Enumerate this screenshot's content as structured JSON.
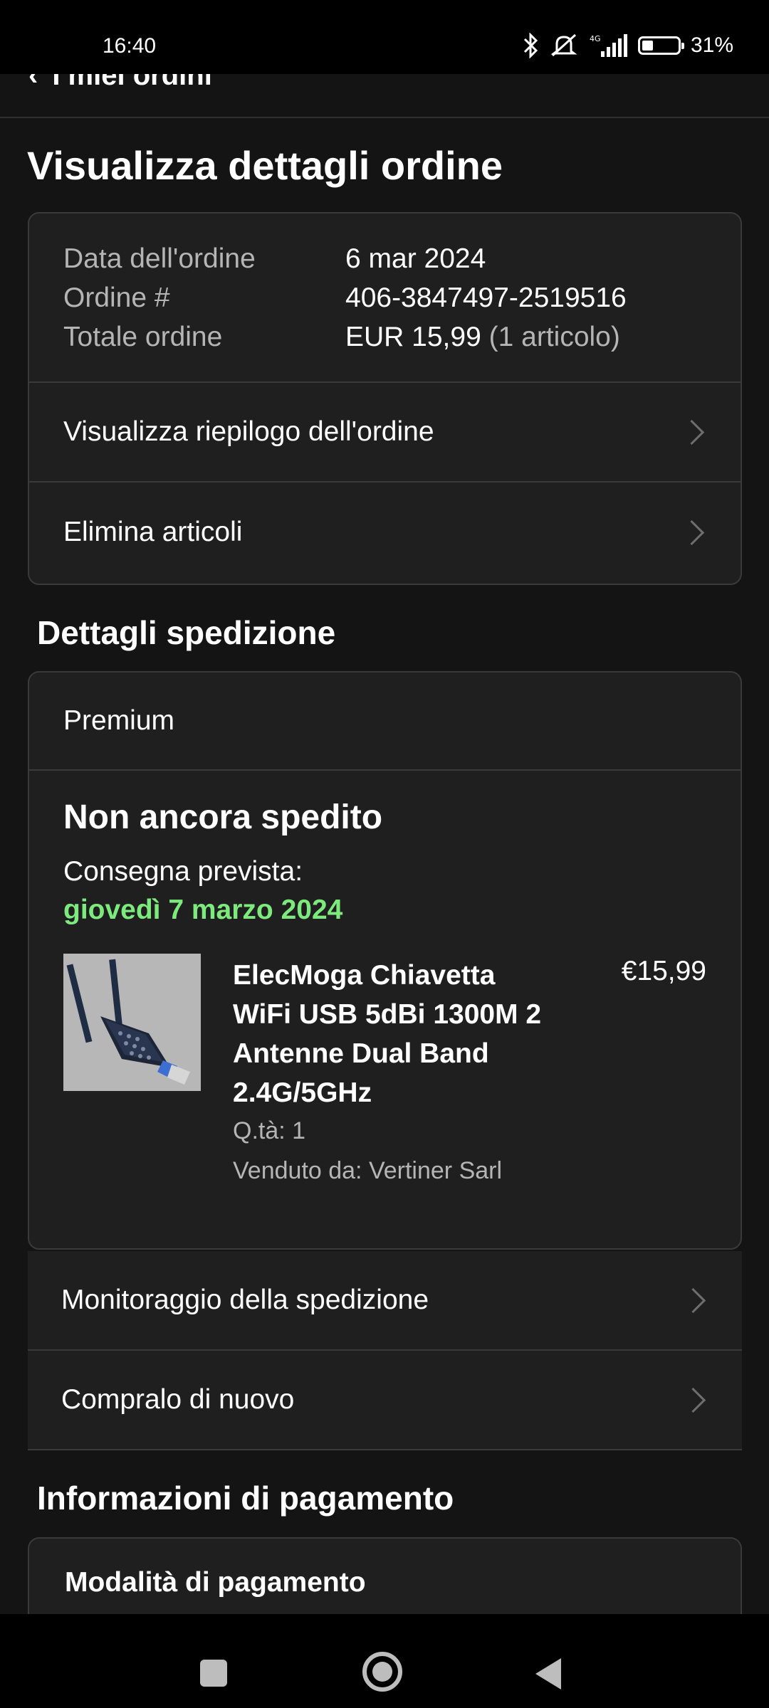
{
  "status_bar": {
    "time": "16:40",
    "network": "4G",
    "battery": "31%",
    "battery_level": 0.31,
    "icons": [
      "bluetooth-icon",
      "mute-icon",
      "signal-icon",
      "battery-icon"
    ]
  },
  "header": {
    "back_label": "I miei ordini"
  },
  "page_title": "Visualizza dettagli ordine",
  "order": {
    "date_label": "Data dell'ordine",
    "date_value": "6 mar 2024",
    "number_label": "Ordine #",
    "number_value": "406-3847497-2519516",
    "total_label": "Totale ordine",
    "total_value": "EUR 15,99",
    "total_count": "(1 articolo)",
    "links": [
      "Visualizza riepilogo dell'ordine",
      "Elimina articoli"
    ]
  },
  "shipping": {
    "section_title": "Dettagli spedizione",
    "service": "Premium",
    "status": "Non ancora spedito",
    "delivery_label": "Consegna prevista:",
    "delivery_date": "giovedì 7 marzo 2024",
    "delivery_date_color": "#7cea7c",
    "product": {
      "title": "ElecMoga Chiavetta WiFi USB 5dBi 1300M 2 Antenne Dual Band 2.4G/5GHz",
      "price": "€15,99",
      "qty": "Q.tà: 1",
      "seller": "Venduto da: Vertiner Sarl"
    },
    "actions": [
      "Monitoraggio della spedizione",
      "Compralo di nuovo"
    ]
  },
  "payment": {
    "section_title": "Informazioni di pagamento",
    "method_label": "Modalità di pagamento"
  }
}
